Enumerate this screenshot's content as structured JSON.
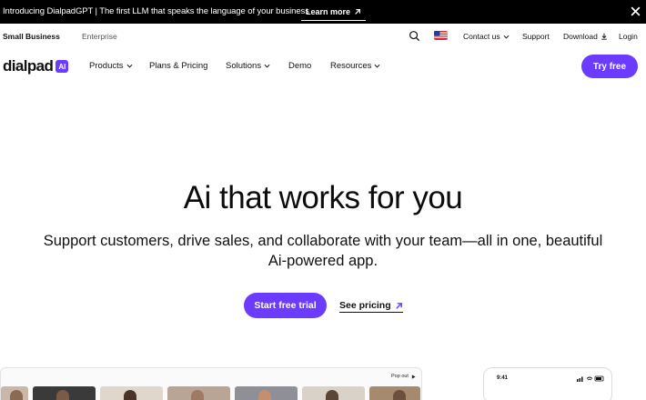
{
  "announcement": {
    "text": "Introducing DialpadGPT | The first LLM that speaks the language of your business",
    "button_label": "Learn more"
  },
  "subnav": {
    "small_business": "Small Business",
    "enterprise": "Enterprise",
    "contact": "Contact us",
    "support": "Support",
    "download": "Download",
    "login": "Login"
  },
  "mainnav": {
    "logo_text": "dialpad",
    "logo_badge": "AI",
    "items": [
      {
        "label": "Products"
      },
      {
        "label": "Plans & Pricing"
      },
      {
        "label": "Solutions"
      },
      {
        "label": "Demo"
      },
      {
        "label": "Resources"
      }
    ],
    "try_label": "Try free"
  },
  "hero": {
    "title": "Ai that works for you",
    "subtitle_line1": "Support customers, drive sales, and collaborate with your team—all in one, beautiful",
    "subtitle_line2": "Ai-powered app.",
    "cta_primary": "Start free trial",
    "cta_secondary": "See pricing"
  },
  "preview": {
    "popout_label": "Pop out",
    "phone_time": "9:41"
  },
  "colors": {
    "brand": "#6b3cff",
    "bar": "#000000"
  }
}
